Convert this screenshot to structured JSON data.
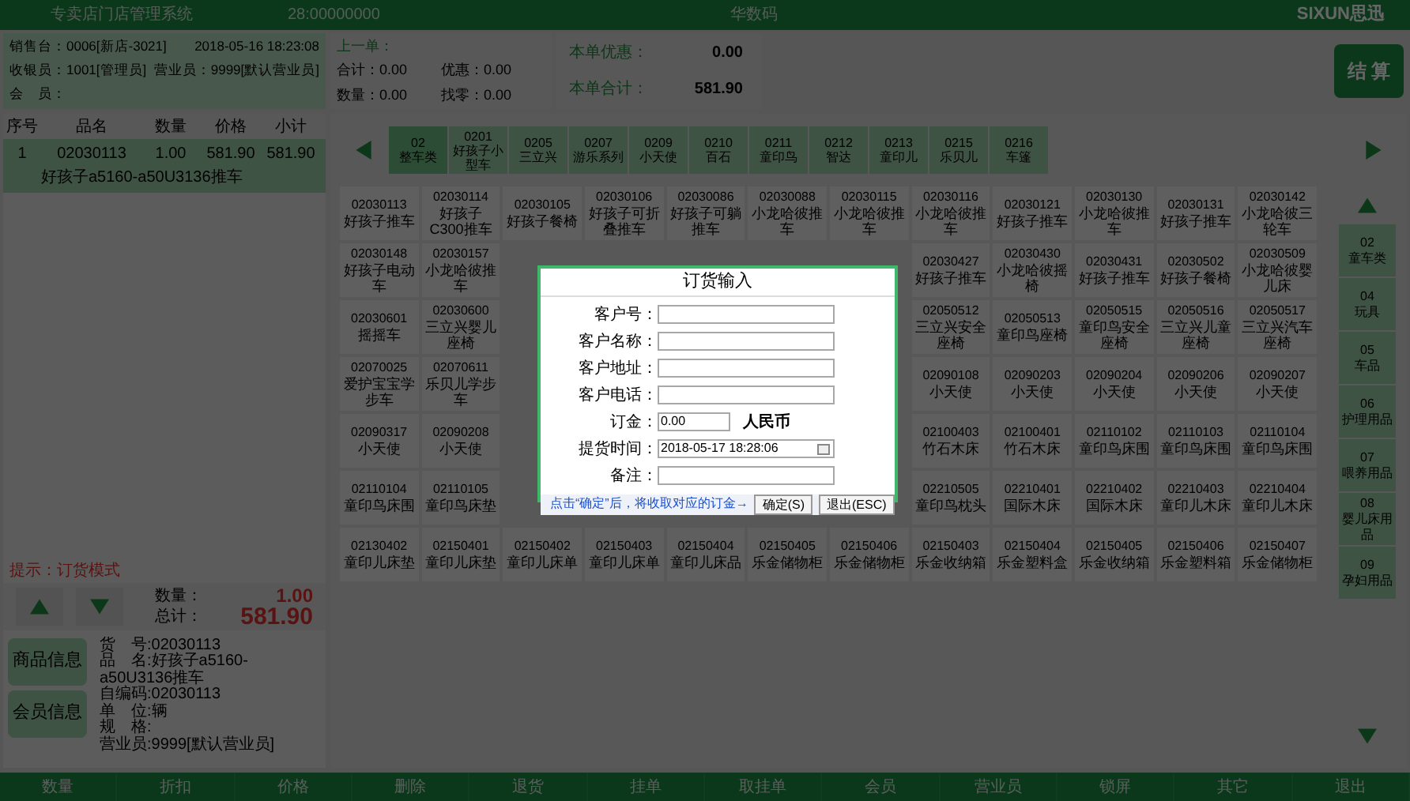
{
  "title_bar": {
    "app": "专卖店门店管理系统",
    "terminal": "28:00000000",
    "mode": "华数码",
    "logo": "SIXUN思迅"
  },
  "info": {
    "pos": "销售台：0006[新店-3021]",
    "time": "2018-05-16 18:23:08",
    "cashier": "收银员：1001[管理员]",
    "clerk": "营业员：9999[默认营业员]",
    "member": "会　员："
  },
  "last_order": {
    "label": "上一单：",
    "total": "合计：0.00",
    "discount": "优惠：0.00",
    "qty": "数量：0.00",
    "change": "找零：0.00"
  },
  "current": {
    "discount_label": "本单优惠：",
    "discount": "0.00",
    "total_label": "本单合计：",
    "total": "581.90"
  },
  "checkout": "结 算",
  "cart": {
    "columns": [
      "序号",
      "品名",
      "数量",
      "价格",
      "小计"
    ],
    "rows": [
      {
        "no": "1",
        "code": "02030113",
        "qty": "1.00",
        "price": "581.90",
        "subtotal": "581.90",
        "name": "好孩子a5160-a50U3136推车",
        "selected": true
      }
    ]
  },
  "hint": "提示：订货模式",
  "summary": {
    "qty_label": "数量：",
    "qty": "1.00",
    "total_label": "总计：",
    "total": "581.90"
  },
  "info_buttons": [
    "商品信息",
    "会员信息"
  ],
  "detail": [
    "货　号:02030113",
    "品　名:好孩子a5160-a50U3136推车",
    "自编码:02030113",
    "单　位:辆",
    "规　格:",
    "营业员:9999[默认营业员]"
  ],
  "categories": [
    {
      "code": "02",
      "name": "整车类",
      "selected": true
    },
    {
      "code": "0201",
      "name": "好孩子小型车",
      "selected": false
    },
    {
      "code": "0205",
      "name": "三立兴",
      "selected": false
    },
    {
      "code": "0207",
      "name": "游乐系列",
      "selected": false
    },
    {
      "code": "0209",
      "name": "小天使",
      "selected": false
    },
    {
      "code": "0210",
      "name": "百石",
      "selected": false
    },
    {
      "code": "0211",
      "name": "童印鸟",
      "selected": false
    },
    {
      "code": "0212",
      "name": "智达",
      "selected": false
    },
    {
      "code": "0213",
      "name": "童印儿",
      "selected": false
    },
    {
      "code": "0215",
      "name": "乐贝儿",
      "selected": false
    },
    {
      "code": "0216",
      "name": "车篷",
      "selected": false
    }
  ],
  "products": [
    {
      "before": [
        {
          "code": "02030113",
          "name": "好孩子推车"
        },
        {
          "code": "02030114",
          "name": "好孩子C300推车"
        },
        {
          "code": "02030105",
          "name": "好孩子餐椅"
        },
        {
          "code": "02030106",
          "name": "好孩子可折叠推车"
        },
        {
          "code": "02030086",
          "name": "好孩子可躺推车"
        },
        {
          "code": "02030088",
          "name": "小龙哈彼推车"
        },
        {
          "code": "02030115",
          "name": "小龙哈彼推车"
        },
        {
          "code": "02030116",
          "name": "小龙哈彼推车"
        },
        {
          "code": "02030121",
          "name": "好孩子推车"
        },
        {
          "code": "02030130",
          "name": "小龙哈彼推车"
        },
        {
          "code": "02030131",
          "name": "好孩子推车"
        },
        {
          "code": "02030142",
          "name": "小龙哈彼三轮车"
        }
      ]
    },
    {
      "before": [
        {
          "code": "02030148",
          "name": "好孩子电动车"
        },
        {
          "code": "02030157",
          "name": "小龙哈彼推车"
        }
      ],
      "after": [
        {
          "code": "02030427",
          "name": "好孩子推车"
        },
        {
          "code": "02030430",
          "name": "小龙哈彼摇椅"
        },
        {
          "code": "02030431",
          "name": "好孩子推车"
        },
        {
          "code": "02030502",
          "name": "好孩子餐椅"
        },
        {
          "code": "02030509",
          "name": "小龙哈彼婴儿床"
        }
      ]
    },
    {
      "before": [
        {
          "code": "02030601",
          "name": "摇摇车"
        },
        {
          "code": "02030600",
          "name": "三立兴婴儿座椅"
        }
      ],
      "after": [
        {
          "code": "02050512",
          "name": "三立兴安全座椅"
        },
        {
          "code": "02050513",
          "name": "童印鸟座椅"
        },
        {
          "code": "02050515",
          "name": "童印鸟安全座椅"
        },
        {
          "code": "02050516",
          "name": "三立兴儿童座椅"
        },
        {
          "code": "02050517",
          "name": "三立兴汽车座椅"
        }
      ]
    },
    {
      "before": [
        {
          "code": "02070025",
          "name": "爱护宝宝学步车"
        },
        {
          "code": "02070611",
          "name": "乐贝儿学步车"
        }
      ],
      "after": [
        {
          "code": "02090108",
          "name": "小天使"
        },
        {
          "code": "02090203",
          "name": "小天使"
        },
        {
          "code": "02090204",
          "name": "小天使"
        },
        {
          "code": "02090206",
          "name": "小天使"
        },
        {
          "code": "02090207",
          "name": "小天使"
        }
      ]
    },
    {
      "before": [
        {
          "code": "02090317",
          "name": "小天使"
        },
        {
          "code": "02090208",
          "name": "小天使"
        }
      ],
      "after": [
        {
          "code": "02100403",
          "name": "竹石木床"
        },
        {
          "code": "02100401",
          "name": "竹石木床"
        },
        {
          "code": "02110102",
          "name": "童印鸟床围"
        },
        {
          "code": "02110103",
          "name": "童印鸟床围"
        },
        {
          "code": "02110104",
          "name": "童印鸟床围"
        }
      ]
    },
    {
      "before": [
        {
          "code": "02110104",
          "name": "童印鸟床围"
        },
        {
          "code": "02110105",
          "name": "童印鸟床垫"
        }
      ],
      "after": [
        {
          "code": "02210505",
          "name": "童印鸟枕头"
        },
        {
          "code": "02210401",
          "name": "国际木床"
        },
        {
          "code": "02210402",
          "name": "国际木床"
        },
        {
          "code": "02210403",
          "name": "童印儿木床"
        },
        {
          "code": "02210404",
          "name": "童印儿木床"
        }
      ]
    },
    {
      "before": [
        {
          "code": "02130402",
          "name": "童印儿床垫"
        },
        {
          "code": "02150401",
          "name": "童印儿床垫"
        },
        {
          "code": "02150402",
          "name": "童印儿床单"
        },
        {
          "code": "02150403",
          "name": "童印儿床单"
        },
        {
          "code": "02150404",
          "name": "童印儿床品"
        },
        {
          "code": "02150405",
          "name": "乐金储物柜"
        },
        {
          "code": "02150406",
          "name": "乐金储物柜"
        },
        {
          "code": "02150403",
          "name": "乐金收纳箱"
        },
        {
          "code": "02150404",
          "name": "乐金塑料盒"
        },
        {
          "code": "02150405",
          "name": "乐金收纳箱"
        },
        {
          "code": "02150406",
          "name": "乐金塑料箱"
        },
        {
          "code": "02150407",
          "name": "乐金储物柜"
        }
      ]
    }
  ],
  "side_categories": [
    {
      "code": "02",
      "name": "童车类"
    },
    {
      "code": "04",
      "name": "玩具"
    },
    {
      "code": "05",
      "name": "车品"
    },
    {
      "code": "06",
      "name": "护理用品"
    },
    {
      "code": "07",
      "name": "喂养用品"
    },
    {
      "code": "08",
      "name": "婴儿床用品"
    },
    {
      "code": "09",
      "name": "孕妇用品"
    }
  ],
  "toolbar": [
    "数量",
    "折扣",
    "价格",
    "删除",
    "退货",
    "挂单",
    "取挂单",
    "会员",
    "营业员",
    "锁屏",
    "其它",
    "退出"
  ],
  "dialog": {
    "title": "订货输入",
    "fields": [
      {
        "label": "客户号：",
        "kind": "text"
      },
      {
        "label": "客户名称：",
        "kind": "text"
      },
      {
        "label": "客户地址：",
        "kind": "text"
      },
      {
        "label": "客户电话：",
        "kind": "text"
      },
      {
        "label": "订金：",
        "kind": "money",
        "value": "0.00",
        "unit": "人民币"
      },
      {
        "label": "提货时间：",
        "kind": "datetime",
        "value": "2018-05-17 18:28:06"
      },
      {
        "label": "备注：",
        "kind": "text"
      }
    ],
    "note": "点击“确定”后，将收取对应的订金→",
    "buttons": [
      "确定(S)",
      "退出(ESC)"
    ]
  }
}
